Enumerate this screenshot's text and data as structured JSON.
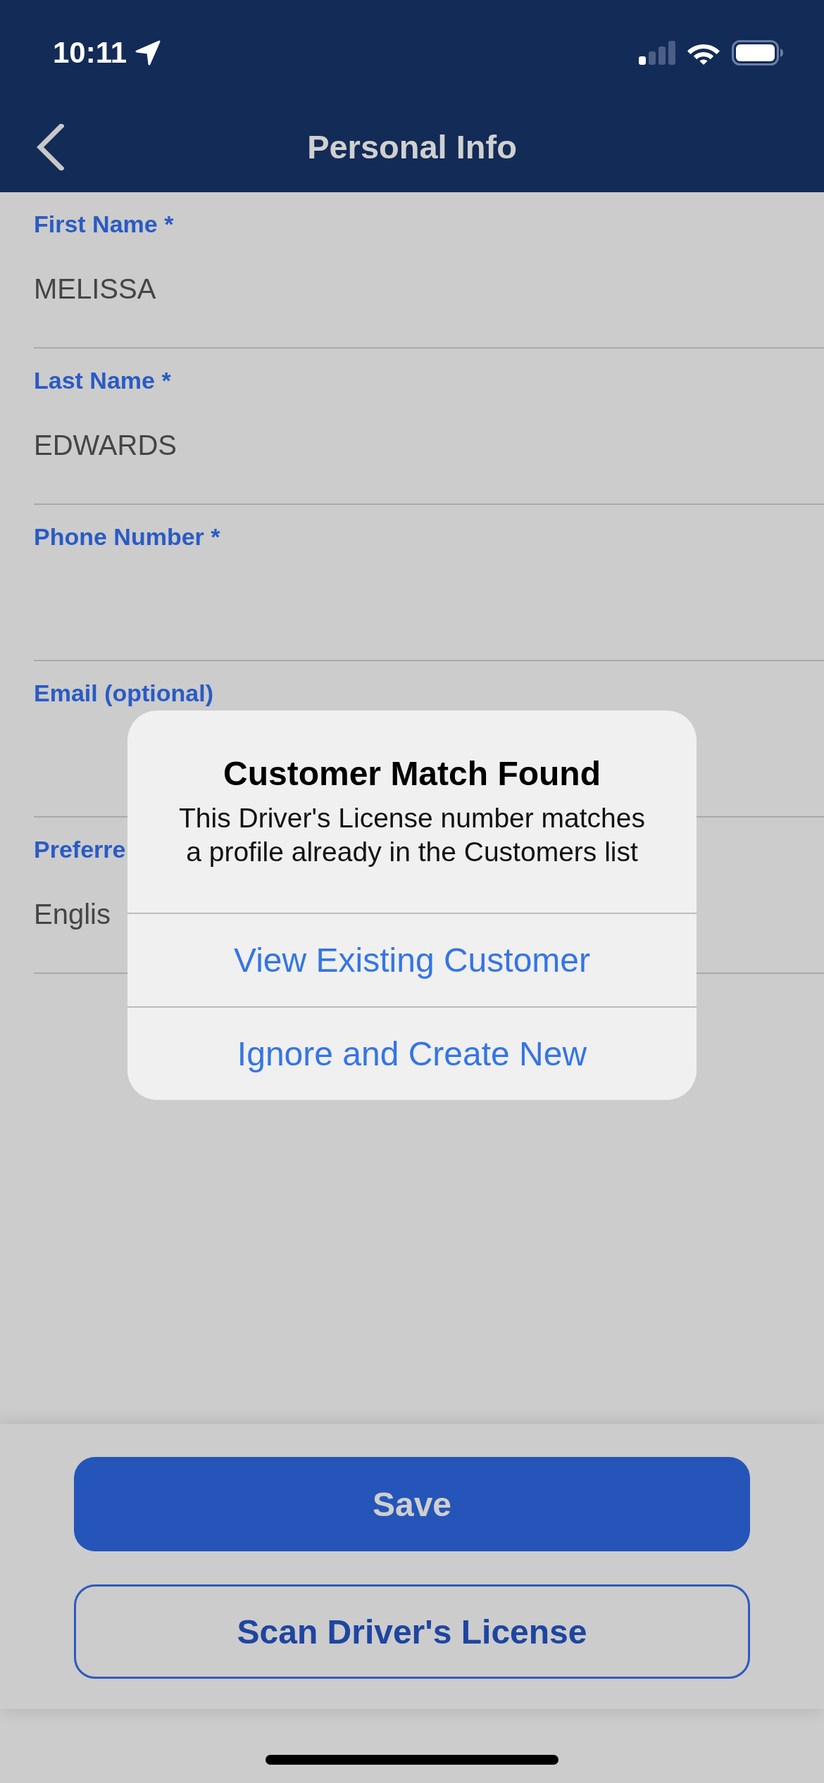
{
  "status_bar": {
    "time": "10:11"
  },
  "nav_bar": {
    "title": "Personal Info"
  },
  "fields": [
    {
      "label": "First Name *",
      "value": "MELISSA"
    },
    {
      "label": "Last Name *",
      "value": "EDWARDS"
    },
    {
      "label": "Phone Number *"
    },
    {
      "label": "Email (optional)"
    },
    {
      "label": "Preferre",
      "value": "Englis"
    }
  ],
  "dialog": {
    "title": "Customer Match Found",
    "message": "This Driver's License number matches a profile already in the Customers list",
    "actions": [
      "View Existing Customer",
      "Ignore and Create New"
    ]
  },
  "buttons": [
    {
      "label": "Save",
      "kind": "primary"
    },
    {
      "label": "Scan Driver's License",
      "kind": "outline"
    }
  ]
}
